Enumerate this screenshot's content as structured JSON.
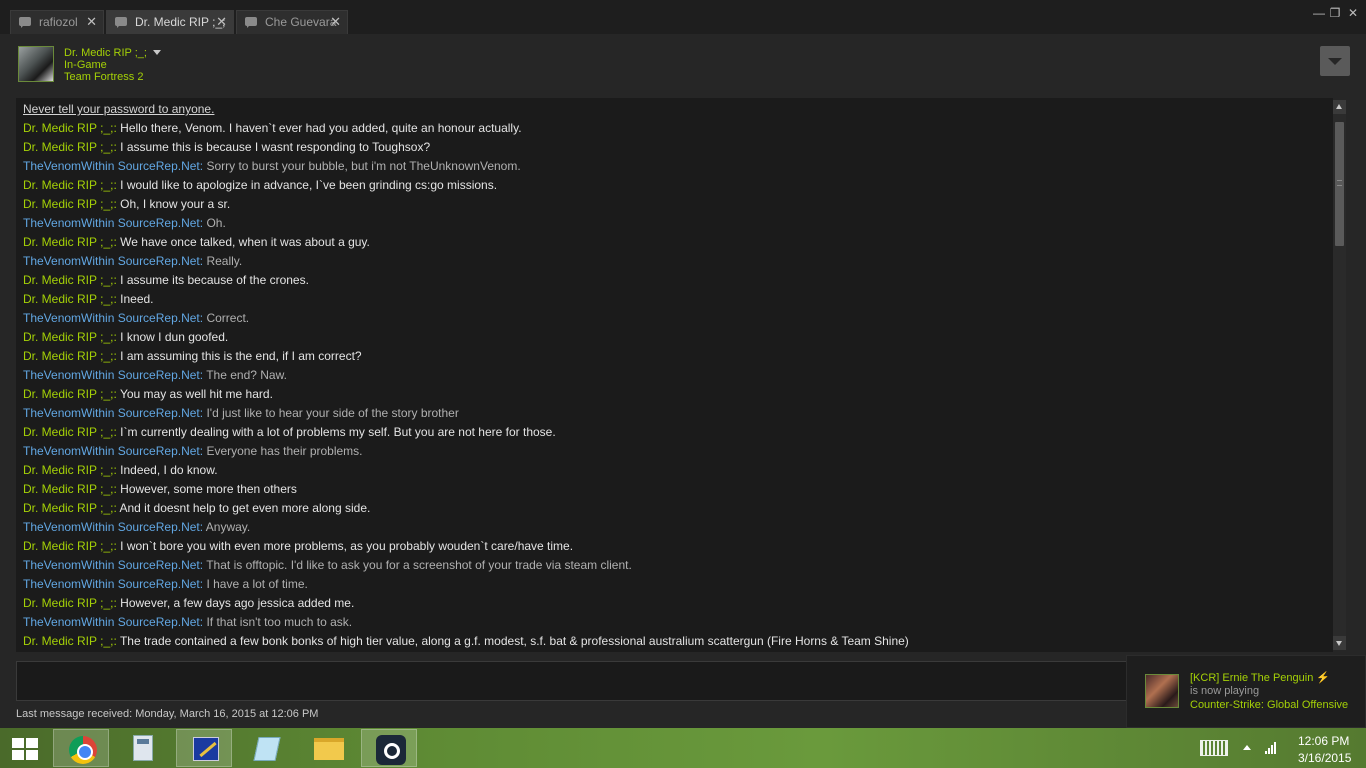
{
  "tabs": [
    {
      "label": "rafiozol",
      "active": false
    },
    {
      "label": "Dr. Medic RIP ;_;",
      "active": true
    },
    {
      "label": "Che Guevara",
      "active": false
    }
  ],
  "window_controls": {
    "minimize": "—",
    "restore": "❐",
    "close": "✕"
  },
  "header": {
    "name": "Dr. Medic RIP ;_;",
    "status": "In-Game",
    "game": "Team Fortress 2"
  },
  "chat": {
    "warning": "Never tell your password to anyone.",
    "separator": ": ",
    "messages": [
      {
        "author": "Dr. Medic RIP ;_;",
        "role": "medic",
        "text": "Hello there, Venom. I haven`t ever had you added, quite an honour actually."
      },
      {
        "author": "Dr. Medic RIP ;_;",
        "role": "medic",
        "text": "I assume this is because I wasnt responding to Toughsox?"
      },
      {
        "author": "TheVenomWithin SourceRep.Net",
        "role": "venom",
        "text": "Sorry to burst your bubble, but i'm not TheUnknownVenom."
      },
      {
        "author": "Dr. Medic RIP ;_;",
        "role": "medic",
        "text": "I would like to apologize in advance, I`ve been grinding cs:go missions."
      },
      {
        "author": "Dr. Medic RIP ;_;",
        "role": "medic",
        "text": "Oh, I know your a sr."
      },
      {
        "author": "TheVenomWithin SourceRep.Net",
        "role": "venom",
        "text": "Oh."
      },
      {
        "author": "Dr. Medic RIP ;_;",
        "role": "medic",
        "text": "We have once talked, when it was about a guy."
      },
      {
        "author": "TheVenomWithin SourceRep.Net",
        "role": "venom",
        "text": "Really."
      },
      {
        "author": "Dr. Medic RIP ;_;",
        "role": "medic",
        "text": "I assume its because of the crones."
      },
      {
        "author": "Dr. Medic RIP ;_;",
        "role": "medic",
        "text": "Ineed."
      },
      {
        "author": "TheVenomWithin SourceRep.Net",
        "role": "venom",
        "text": "Correct."
      },
      {
        "author": "Dr. Medic RIP ;_;",
        "role": "medic",
        "text": "I know I dun goofed."
      },
      {
        "author": "Dr. Medic RIP ;_;",
        "role": "medic",
        "text": "I am assuming this is the end, if I am correct?"
      },
      {
        "author": "TheVenomWithin SourceRep.Net",
        "role": "venom",
        "text": "The end? Naw."
      },
      {
        "author": "Dr. Medic RIP ;_;",
        "role": "medic",
        "text": "You may as well hit me hard."
      },
      {
        "author": "TheVenomWithin SourceRep.Net",
        "role": "venom",
        "text": "I'd just like to hear your side of the story brother"
      },
      {
        "author": "Dr. Medic RIP ;_;",
        "role": "medic",
        "text": "I`m currently dealing with a lot of problems my self. But you are not here for those."
      },
      {
        "author": "TheVenomWithin SourceRep.Net",
        "role": "venom",
        "text": "Everyone has their problems."
      },
      {
        "author": "Dr. Medic RIP ;_;",
        "role": "medic",
        "text": "Indeed, I do know."
      },
      {
        "author": "Dr. Medic RIP ;_;",
        "role": "medic",
        "text": "However, some more then others"
      },
      {
        "author": "Dr. Medic RIP ;_;",
        "role": "medic",
        "text": "And it doesnt help to get even more along side."
      },
      {
        "author": "TheVenomWithin SourceRep.Net",
        "role": "venom",
        "text": "Anyway."
      },
      {
        "author": "Dr. Medic RIP ;_;",
        "role": "medic",
        "text": "I won`t bore you with even more problems, as you probably wouden`t care/have time."
      },
      {
        "author": "TheVenomWithin SourceRep.Net",
        "role": "venom",
        "text": "That is offtopic. I'd like to ask you for a screenshot of your trade via steam client."
      },
      {
        "author": "TheVenomWithin SourceRep.Net",
        "role": "venom",
        "text": "I have a lot of time."
      },
      {
        "author": "Dr. Medic RIP ;_;",
        "role": "medic",
        "text": "However, a few days ago jessica added me."
      },
      {
        "author": "TheVenomWithin SourceRep.Net",
        "role": "venom",
        "text": "If that isn't too much to ask."
      },
      {
        "author": "Dr. Medic RIP ;_;",
        "role": "medic",
        "text": "The trade contained a few bonk bonks of high tier value, along a g.f. modest, s.f. bat & professional australium scattergun (Fire Horns & Team Shine)"
      }
    ]
  },
  "footer": {
    "last_message": "Last message received: Monday, March 16, 2015 at 12:06 PM",
    "input_value": ""
  },
  "notification": {
    "name": "[KCR] Ernie The Penguin ⚡",
    "action": "is now playing",
    "game": "Counter-Strike: Global Offensive"
  },
  "taskbar": {
    "apps": [
      "start-icon",
      "chrome-icon",
      "calculator-icon",
      "pen-app-icon",
      "notes-icon",
      "file-explorer-icon",
      "steam-icon"
    ],
    "clock_time": "12:06 PM",
    "clock_date": "3/16/2015"
  },
  "colors": {
    "medic_name": "#a4d007",
    "venom_name": "#62a7e3",
    "background": "#262626"
  }
}
